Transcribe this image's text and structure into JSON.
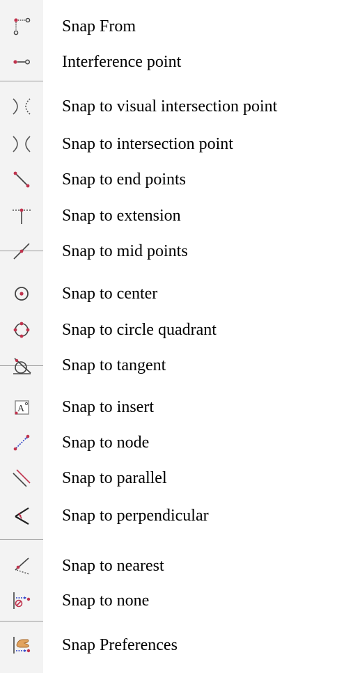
{
  "menu": {
    "items": [
      {
        "label": "Snap From",
        "icon": "snap-from-icon"
      },
      {
        "label": "Interference point",
        "icon": "interference-point-icon"
      },
      {
        "label": "Snap to visual intersection point",
        "icon": "visual-intersection-icon"
      },
      {
        "label": "Snap to intersection point",
        "icon": "intersection-icon"
      },
      {
        "label": "Snap to end points",
        "icon": "end-points-icon"
      },
      {
        "label": "Snap to extension",
        "icon": "extension-icon"
      },
      {
        "label": "Snap to mid points",
        "icon": "mid-points-icon"
      },
      {
        "label": "Snap to center",
        "icon": "center-icon"
      },
      {
        "label": "Snap to circle quadrant",
        "icon": "circle-quadrant-icon"
      },
      {
        "label": "Snap to tangent",
        "icon": "tangent-icon"
      },
      {
        "label": "Snap to insert",
        "icon": "insert-icon"
      },
      {
        "label": "Snap to node",
        "icon": "node-icon"
      },
      {
        "label": "Snap to parallel",
        "icon": "parallel-icon"
      },
      {
        "label": "Snap to perpendicular",
        "icon": "perpendicular-icon"
      },
      {
        "label": "Snap to nearest",
        "icon": "nearest-icon"
      },
      {
        "label": "Snap to none",
        "icon": "snap-none-icon"
      },
      {
        "label": "Snap Preferences",
        "icon": "snap-preferences-icon"
      }
    ]
  },
  "colors": {
    "toolbar_bg": "#f3f3f3",
    "separator": "#9a9a9a",
    "icon_stroke": "#444444",
    "accent_red": "#c0334d",
    "accent_blue": "#2b3fc7"
  }
}
